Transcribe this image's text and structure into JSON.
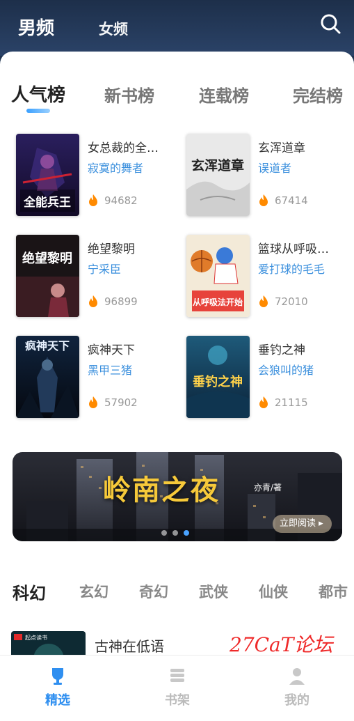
{
  "gender_tabs": {
    "male": "男频",
    "female": "女频"
  },
  "rank_tabs": [
    "人气榜",
    "新书榜",
    "连载榜",
    "完结榜"
  ],
  "books": [
    {
      "title": "女总裁的全…",
      "author": "寂寞的舞者",
      "heat": "94682",
      "cover_text": "全能兵王"
    },
    {
      "title": "玄浑道章",
      "author": "误道者",
      "heat": "67414",
      "cover_text": "玄浑道章"
    },
    {
      "title": "绝望黎明",
      "author": "宁采臣",
      "heat": "96899",
      "cover_text": "绝望黎明"
    },
    {
      "title": "篮球从呼吸…",
      "author": "爱打球的毛毛",
      "heat": "72010",
      "cover_text": "从呼吸法开始"
    },
    {
      "title": "疯神天下",
      "author": "黑甲三猪",
      "heat": "57902",
      "cover_text": "疯神天下"
    },
    {
      "title": "垂钓之神",
      "author": "会狼叫的猪",
      "heat": "21115",
      "cover_text": "垂钓之神"
    }
  ],
  "banner": {
    "title": "岭南之夜",
    "author": "亦青/著",
    "read_button": "立即阅读 ▸"
  },
  "category_tabs": [
    "科幻",
    "玄幻",
    "奇幻",
    "武侠",
    "仙侠",
    "都市"
  ],
  "list_item": {
    "title": "古神在低语",
    "cover_badge": "起点读书"
  },
  "bottom_nav": [
    {
      "label": "精选",
      "icon": "trophy-icon"
    },
    {
      "label": "书架",
      "icon": "bookshelf-icon"
    },
    {
      "label": "我的",
      "icon": "user-icon"
    }
  ],
  "watermark": "27CaT论坛",
  "colors": {
    "accent": "#2f8ff0",
    "author": "#3a8fdd",
    "heat": "#ff8a00"
  }
}
